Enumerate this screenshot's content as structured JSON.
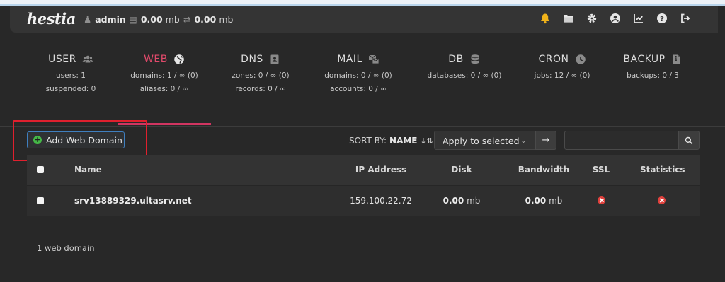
{
  "topbar": {
    "logo": "hestia",
    "user": "admin",
    "disk_value": "0.00",
    "disk_unit": "mb",
    "bandwidth_value": "0.00",
    "bandwidth_unit": "mb",
    "icons": [
      "bell-icon",
      "folder-icon",
      "gear-icon",
      "user-circle-icon",
      "chart-icon",
      "help-icon",
      "logout-icon"
    ]
  },
  "stats": {
    "user": {
      "title": "USER",
      "icon": "users-icon",
      "lines": [
        "users: 1",
        "suspended: 0"
      ]
    },
    "web": {
      "title": "WEB",
      "icon": "globe-icon",
      "lines": [
        "domains: 1 / ∞ (0)",
        "aliases: 0 / ∞"
      ]
    },
    "dns": {
      "title": "DNS",
      "icon": "address-book-icon",
      "lines": [
        "zones: 0 / ∞ (0)",
        "records: 0 / ∞"
      ]
    },
    "mail": {
      "title": "MAIL",
      "icon": "mail-bulk-icon",
      "lines": [
        "domains: 0 / ∞ (0)",
        "accounts: 0 / ∞"
      ]
    },
    "db": {
      "title": "DB",
      "icon": "database-icon",
      "lines": [
        "databases: 0 / ∞ (0)"
      ]
    },
    "cron": {
      "title": "CRON",
      "icon": "clock-icon",
      "lines": [
        "jobs: 12 / ∞ (0)"
      ]
    },
    "backup": {
      "title": "BACKUP",
      "icon": "file-archive-icon",
      "lines": [
        "backups: 0 / 3"
      ]
    }
  },
  "toolbar": {
    "add_label": "Add Web Domain",
    "sort_label": "SORT BY:",
    "sort_value": "NAME",
    "bulk_select": "Apply to selected",
    "apply_arrow": "→",
    "search_value": ""
  },
  "table": {
    "headers": {
      "name": "Name",
      "ip": "IP Address",
      "disk": "Disk",
      "bandwidth": "Bandwidth",
      "ssl": "SSL",
      "statistics": "Statistics"
    },
    "rows": [
      {
        "name": "srv13889329.ultasrv.net",
        "ip": "159.100.22.72",
        "disk": "0.00",
        "disk_unit": "mb",
        "bandwidth": "0.00",
        "bandwidth_unit": "mb",
        "ssl": "disabled",
        "statistics": "disabled"
      }
    ]
  },
  "footer": {
    "count": "1 web domain"
  },
  "colors": {
    "accent": "#d13561",
    "add_button_border": "#3f7fbf",
    "highlight": "#e0202e",
    "status_off": "#e0413d",
    "notification": "#f1b31a"
  }
}
